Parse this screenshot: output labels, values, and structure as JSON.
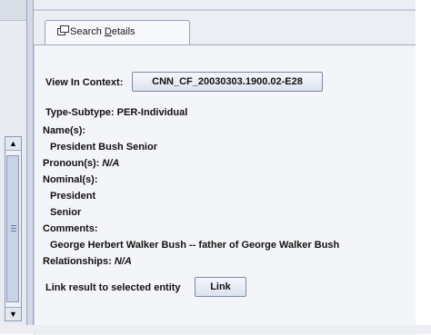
{
  "tab": {
    "label_prefix": "Search ",
    "label_underlined": "D",
    "label_rest": "etails"
  },
  "context": {
    "label": "View In Context:",
    "button": "CNN_CF_20030303.1900.02-E28"
  },
  "type_subtype": {
    "label": "Type-Subtype:",
    "value": "PER-Individual"
  },
  "names": {
    "label": "Name(s):",
    "values": [
      "President Bush Senior"
    ]
  },
  "pronouns": {
    "label": "Pronoun(s):",
    "value": "N/A"
  },
  "nominals": {
    "label": "Nominal(s):",
    "values": [
      "President",
      "Senior"
    ]
  },
  "comments": {
    "label": "Comments:",
    "value": "George Herbert Walker Bush -- father of George Walker Bush"
  },
  "relationships": {
    "label": "Relationships:",
    "value": "N/A"
  },
  "link": {
    "label": "Link result to selected entity",
    "button": "Link"
  },
  "icons": {
    "tab": "window-icon",
    "scroll_up": "arrow-up-icon",
    "scroll_down": "arrow-down-icon"
  }
}
